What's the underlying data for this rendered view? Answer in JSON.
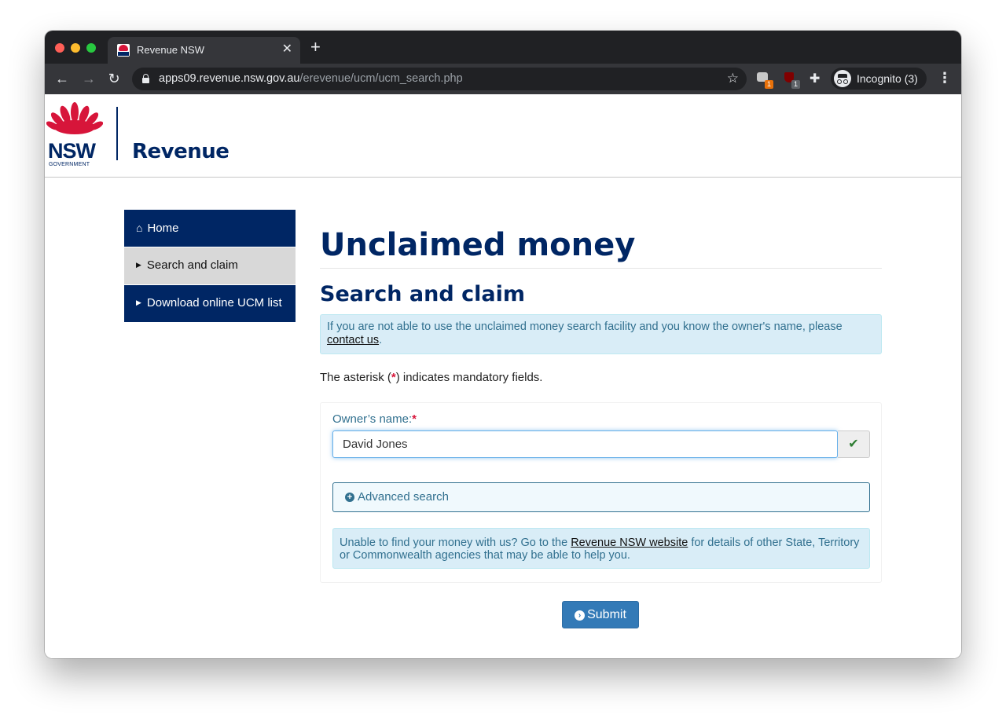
{
  "browser": {
    "tab_title": "Revenue NSW",
    "tab_close": "✕",
    "new_tab": "+",
    "url_host": "apps09.revenue.nsw.gov.au",
    "url_path": "/erevenue/ucm/ucm_search.php",
    "extension_badges": [
      "1",
      "1"
    ],
    "incognito_label": "Incognito (3)"
  },
  "header": {
    "logo_text": "NSW",
    "logo_subtext": "GOVERNMENT",
    "site_title": "Revenue"
  },
  "sidebar": {
    "items": [
      {
        "label": "Home",
        "icon": "home-icon",
        "active": false
      },
      {
        "label": "Search and claim",
        "icon": "caret-right-icon",
        "active": true
      },
      {
        "label": "Download online UCM list",
        "icon": "caret-right-icon",
        "active": false
      }
    ]
  },
  "main": {
    "title": "Unclaimed money",
    "section_title": "Search and claim",
    "info_text_before": "If you are not able to use the unclaimed money search facility and you know the owner's name, please ",
    "info_link": "contact us",
    "info_text_after": ".",
    "mandatory_before": "The asterisk (",
    "mandatory_star": "*",
    "mandatory_after": ") indicates mandatory fields."
  },
  "form": {
    "owner_label": "Owner’s name:",
    "required_star": "*",
    "owner_value": "David Jones",
    "advanced_search_label": "Advanced search",
    "help_text_before": "Unable to find your money with us? Go to the ",
    "help_link": "Revenue NSW website",
    "help_text_after": " for details of other State, Territory or Commonwealth agencies that may be able to help you.",
    "submit_label": "Submit"
  },
  "colors": {
    "brand_navy": "#002664",
    "brand_red": "#d7153a",
    "info_bg": "#d9edf7",
    "info_text": "#31708f",
    "button_blue": "#337ab7"
  }
}
